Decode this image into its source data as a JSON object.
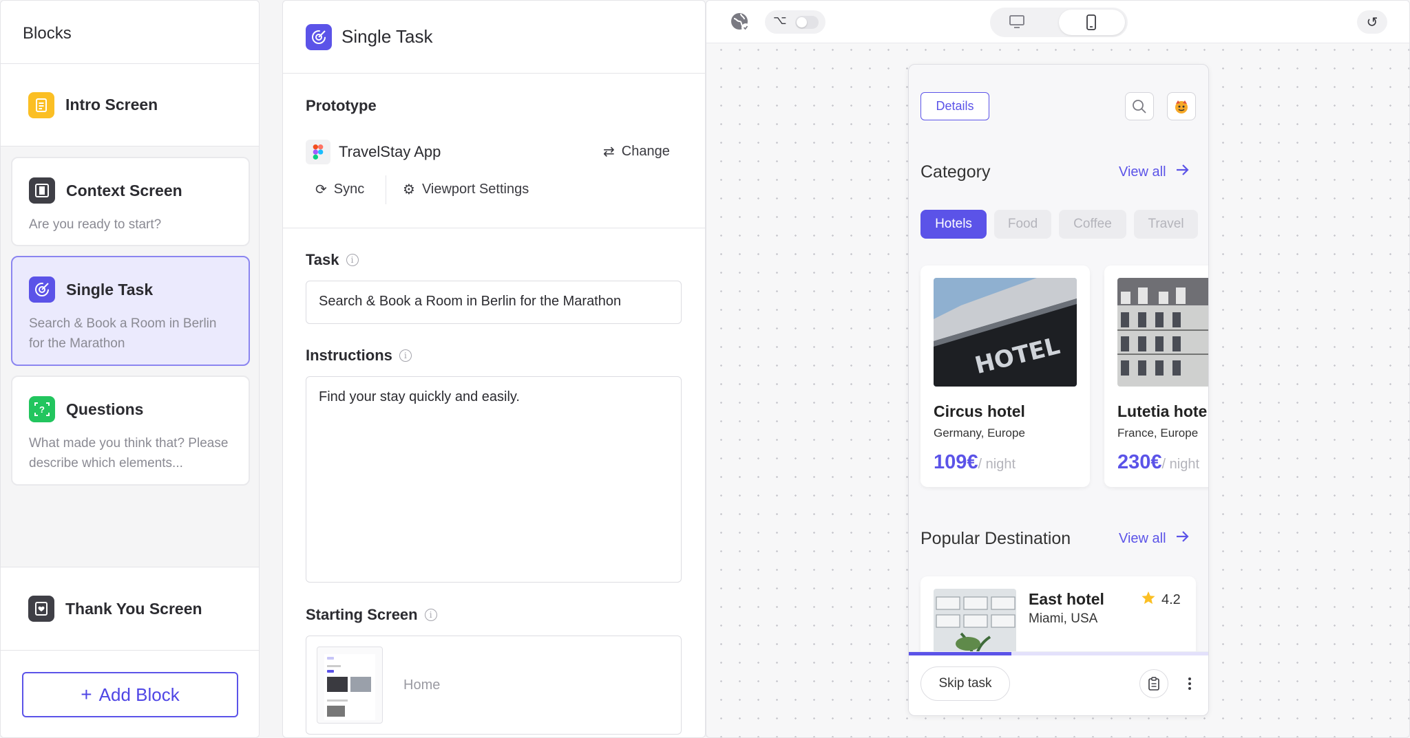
{
  "blocks_panel": {
    "title": "Blocks",
    "intro": {
      "label": "Intro Screen"
    },
    "items": [
      {
        "title": "Context Screen",
        "subtitle": "Are you ready to start?"
      },
      {
        "title": "Single Task",
        "subtitle": "Search & Book a Room in Berlin for the Marathon"
      },
      {
        "title": "Questions",
        "subtitle": "What made you think that? Please describe which elements..."
      }
    ],
    "thank_you": {
      "label": "Thank You Screen"
    },
    "add_block": {
      "label": "Add Block"
    }
  },
  "editor": {
    "title": "Single Task",
    "prototype": {
      "heading": "Prototype",
      "name": "TravelStay App",
      "change_label": "Change",
      "sync_label": "Sync",
      "viewport_label": "Viewport Settings"
    },
    "task": {
      "heading": "Task",
      "value": "Search & Book a Room in Berlin for the Marathon"
    },
    "instructions": {
      "heading": "Instructions",
      "value": "Find your stay quickly and easily."
    },
    "starting_screen": {
      "heading": "Starting Screen",
      "value": "Home"
    }
  },
  "preview": {
    "view_mode": "mobile",
    "phone": {
      "details_label": "Details",
      "category": {
        "heading": "Category",
        "view_all": "View all",
        "chips": [
          "Hotels",
          "Food",
          "Coffee",
          "Travel"
        ],
        "active_chip": "Hotels"
      },
      "hotels": [
        {
          "name": "Circus hotel",
          "location": "Germany, Europe",
          "price": "109€",
          "unit": "/ night"
        },
        {
          "name": "Lutetia hotel",
          "location": "France, Europe",
          "price": "230€",
          "unit": "/ night"
        }
      ],
      "popular": {
        "heading": "Popular Destination",
        "view_all": "View all",
        "item": {
          "name": "East hotel",
          "location": "Miami, USA",
          "rating": "4.2"
        }
      },
      "hotel_sign": "HOTEL",
      "progress": 0.34,
      "skip_label": "Skip task"
    }
  },
  "colors": {
    "accent": "#5b53e8",
    "selected_bg": "#ebeafd",
    "intro_icon": "#fbbf24",
    "questions_icon": "#22c55e",
    "dark_icon": "#3f3f46"
  }
}
